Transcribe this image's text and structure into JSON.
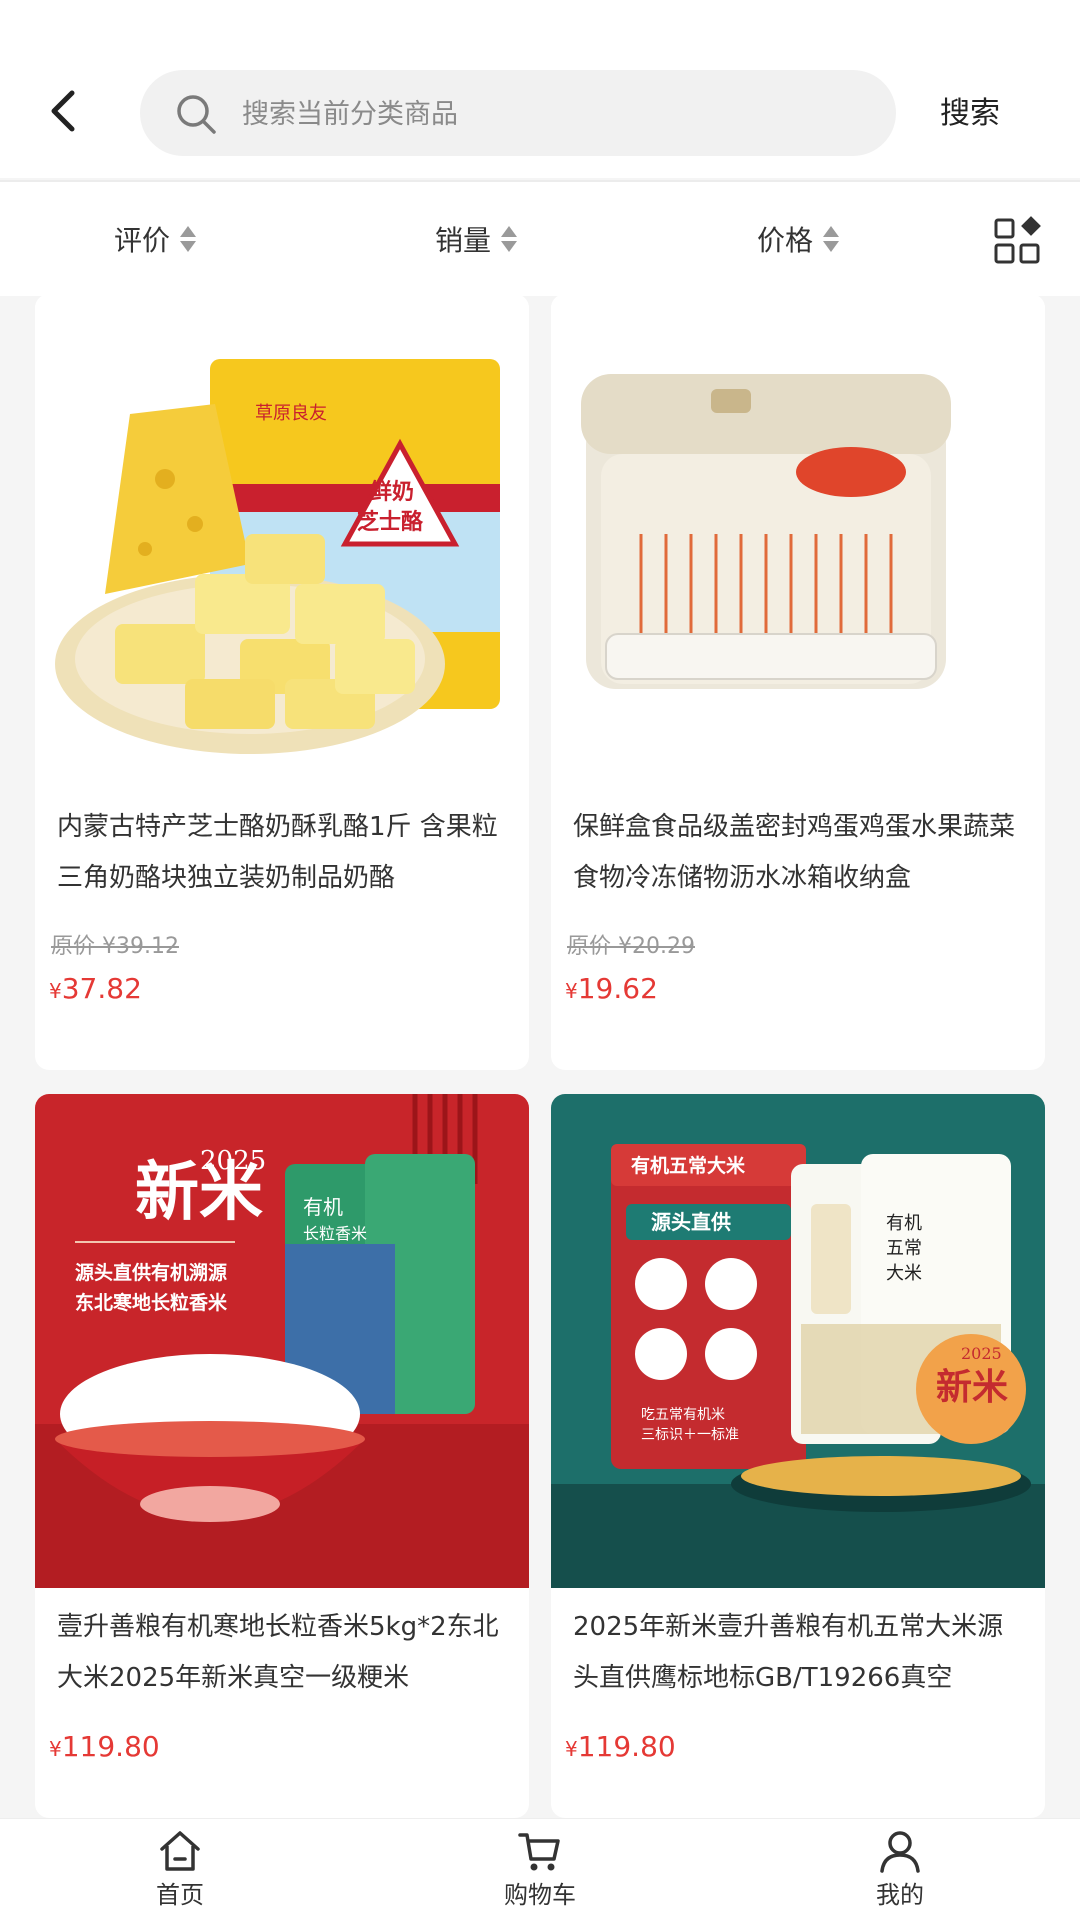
{
  "header": {
    "search_placeholder": "搜索当前分类商品",
    "search_button": "搜索"
  },
  "sort_bar": {
    "items": [
      {
        "label": "评价"
      },
      {
        "label": "销量"
      },
      {
        "label": "价格"
      }
    ]
  },
  "products": [
    {
      "title": "内蒙古特产芝士酪奶酥乳酪1斤 含果粒三角奶酪块独立装奶制品奶酪",
      "original_price": "原价 ¥39.12",
      "price_symbol": "¥",
      "price": "37.82",
      "image": "cheese-product-image",
      "image_texts": [
        "草原良友",
        "鲜奶",
        "芝士酪"
      ]
    },
    {
      "title": "保鲜盒食品级盖密封鸡蛋鸡蛋水果蔬菜食物冷冻储物沥水冰箱收纳盒",
      "original_price": "原价 ¥20.29",
      "price_symbol": "¥",
      "price": "19.62",
      "image": "storage-box-product-image"
    },
    {
      "title": "壹升善粮有机寒地长粒香米5kg*2东北大米2025年新米真空一级粳米",
      "original_price": "",
      "price_symbol": "¥",
      "price": "119.80",
      "image": "rice-bowl-product-image",
      "image_texts": [
        "新米",
        "2025",
        "源头直供有机溯源",
        "东北寒地长粒香米",
        "有机长粒香米"
      ]
    },
    {
      "title": "2025年新米壹升善粮有机五常大米源头直供鹰标地标GB/T19266真空",
      "original_price": "",
      "price_symbol": "¥",
      "price": "119.80",
      "image": "wuchang-rice-product-image",
      "image_texts": [
        "有机五常大米",
        "源头直供",
        "吃五常有机米",
        "三标识＋一标准",
        "有机五常大米",
        "新米",
        "2025"
      ]
    }
  ],
  "bottom_nav": {
    "items": [
      {
        "label": "首页",
        "icon": "home-icon"
      },
      {
        "label": "购物车",
        "icon": "cart-icon"
      },
      {
        "label": "我的",
        "icon": "user-icon"
      }
    ]
  },
  "colors": {
    "price": "#e53935",
    "background": "#f5f5f5"
  }
}
